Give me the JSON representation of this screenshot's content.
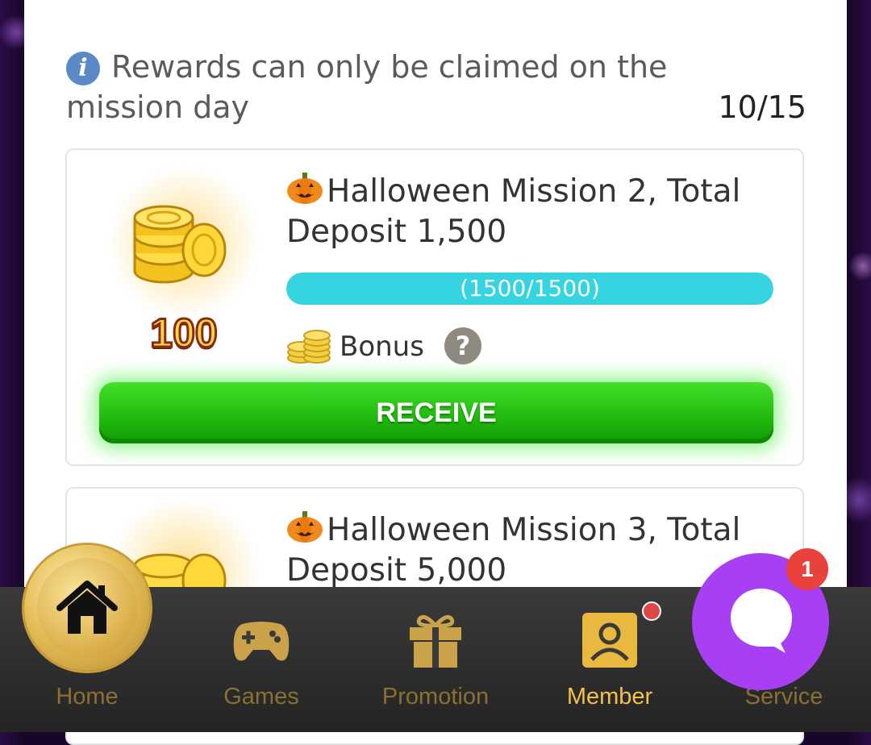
{
  "notice": {
    "icon": "info-icon",
    "text": "Rewards can only be claimed on the mission day",
    "count": "10/15"
  },
  "missions": [
    {
      "title": "Halloween Mission 2, Total Deposit 1,500",
      "reward_amount": "100",
      "progress_text": "(1500/1500)",
      "progress_fraction": 1.0,
      "bonus_label": "Bonus",
      "button_label": "RECEIVE"
    },
    {
      "title": "Halloween Mission 3, Total Deposit 5,000"
    }
  ],
  "nav": {
    "items": [
      {
        "label": "Home",
        "icon": "home-icon"
      },
      {
        "label": "Games",
        "icon": "gamepad-icon"
      },
      {
        "label": "Promotion",
        "icon": "gift-icon"
      },
      {
        "label": "Member",
        "icon": "member-icon",
        "active": true
      },
      {
        "label": "Service",
        "icon": "chat-icon"
      }
    ],
    "service_badge": "1"
  },
  "colors": {
    "accent_gold": "#f2c24a",
    "progress": "#35d4e0",
    "receive": "#1fb80d",
    "chat": "#a93ff2",
    "badge": "#e9423a"
  }
}
